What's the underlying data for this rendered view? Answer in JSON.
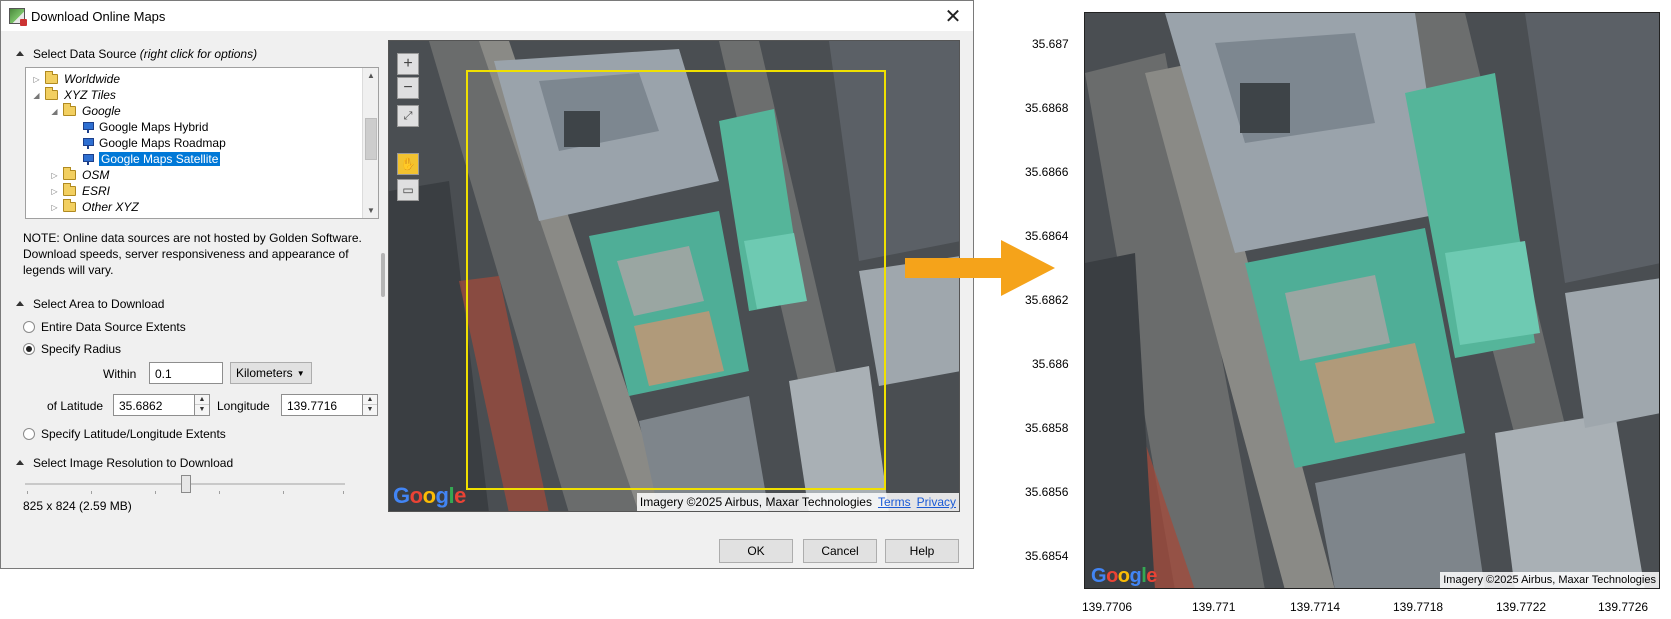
{
  "dialog": {
    "title": "Download Online Maps",
    "close_glyph": "✕",
    "source_section": {
      "label": "Select Data Source",
      "hint": "(right click for options)"
    },
    "tree": [
      {
        "label": "Worldwide",
        "type": "folder",
        "expander": "▷",
        "italic": true
      },
      {
        "label": "XYZ Tiles",
        "type": "folder",
        "expander": "◢",
        "italic": true
      },
      {
        "label": "Google",
        "type": "folder",
        "expander": "◢",
        "italic": true
      },
      {
        "label": "Google Maps Hybrid",
        "type": "source"
      },
      {
        "label": "Google Maps Roadmap",
        "type": "source"
      },
      {
        "label": "Google Maps Satellite",
        "type": "source",
        "selected": true
      },
      {
        "label": "OSM",
        "type": "folder",
        "expander": "▷",
        "italic": true
      },
      {
        "label": "ESRI",
        "type": "folder",
        "expander": "▷",
        "italic": true
      },
      {
        "label": "Other XYZ",
        "type": "folder",
        "expander": "▷",
        "italic": true
      }
    ],
    "note": "NOTE: Online data sources are not hosted by Golden Software. Download speeds, server responsiveness and appearance of legends will vary.",
    "area_section": {
      "label": "Select Area to Download",
      "option_entire": "Entire Data Source Extents",
      "option_radius": "Specify Radius",
      "option_extents": "Specify Latitude/Longitude Extents",
      "within_label": "Within",
      "within_value": "0.1",
      "units": "Kilometers",
      "lat_label": "of Latitude",
      "lat_value": "35.6862",
      "lon_label": "Longitude",
      "lon_value": "139.7716"
    },
    "resolution_section": {
      "label": "Select Image Resolution to Download",
      "resolution_text": "825 x 824  (2.59 MB)"
    },
    "buttons": {
      "ok": "OK",
      "cancel": "Cancel",
      "help": "Help"
    },
    "map_preview": {
      "attribution": "Imagery ©2025 Airbus, Maxar Technologies",
      "terms": "Terms",
      "privacy": "Privacy",
      "logo_text": "Google"
    }
  },
  "output_map": {
    "attribution": "Imagery ©2025 Airbus, Maxar Technologies",
    "logo_text": "Google",
    "y_ticks": [
      "35.687",
      "35.6868",
      "35.6866",
      "35.6864",
      "35.6862",
      "35.686",
      "35.6858",
      "35.6856",
      "35.6854"
    ],
    "x_ticks": [
      "139.7706",
      "139.771",
      "139.7714",
      "139.7718",
      "139.7722",
      "139.7726"
    ]
  },
  "colors": {
    "accent_arrow": "#f5a31a",
    "selection_box": "#f0e000",
    "selected_item": "#0078d7"
  }
}
